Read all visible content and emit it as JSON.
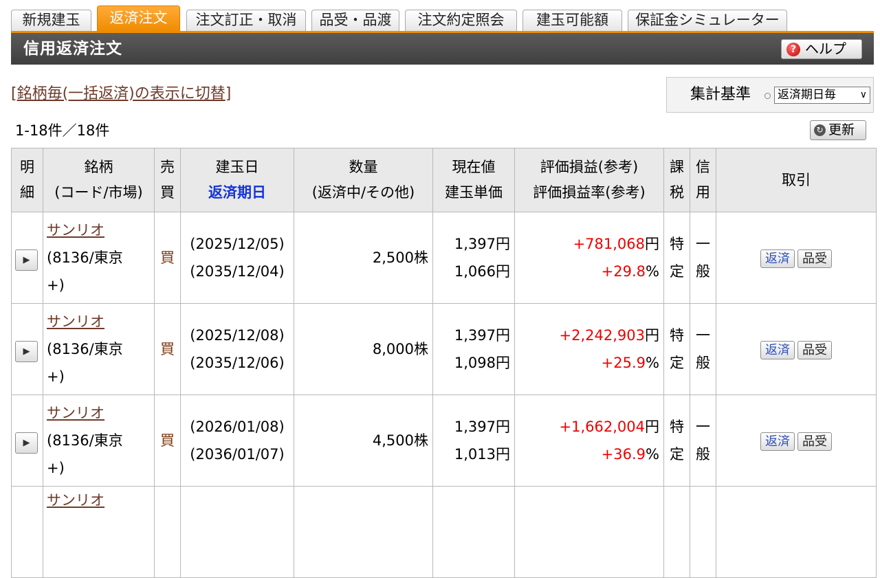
{
  "tabs": [
    {
      "label": "新規建玉",
      "active": false
    },
    {
      "label": "返済注文",
      "active": true
    },
    {
      "label": "注文訂正・取消",
      "active": false
    },
    {
      "label": "品受・品渡",
      "active": false
    },
    {
      "label": "注文約定照会",
      "active": false
    },
    {
      "label": "建玉可能額",
      "active": false
    },
    {
      "label": "保証金シミュレーター",
      "active": false
    }
  ],
  "title": "信用返済注文",
  "help_label": "ヘルプ",
  "toggle": {
    "open": "[",
    "label": "銘柄毎(一括返済)の表示に切替",
    "close": "]"
  },
  "aggregation": {
    "label": "集計基準",
    "selected": "返済期日毎"
  },
  "count": "1-18件／18件",
  "refresh_label": "更新",
  "headers": {
    "detail": [
      "明",
      "細"
    ],
    "stock": [
      "銘柄",
      "(コード/市場)"
    ],
    "side": [
      "売",
      "買"
    ],
    "date": [
      "建玉日",
      "返済期日"
    ],
    "qty": [
      "数量",
      "(返済中/その他)"
    ],
    "price": [
      "現在値",
      "建玉単価"
    ],
    "pl": [
      "評価損益(参考)",
      "評価損益率(参考)"
    ],
    "tax": [
      "課",
      "税"
    ],
    "credit": [
      "信",
      "用"
    ],
    "trade": "取引"
  },
  "rows": [
    {
      "name": "サンリオ",
      "code": "(8136/東京",
      "market": "+)",
      "side": "買",
      "open_date": "(2025/12/05)",
      "due_date": "(2035/12/04)",
      "qty": "2,500株",
      "current": "1,397円",
      "unit": "1,066円",
      "pl": "+781,068",
      "pl_unit": "円",
      "plr": "+29.8",
      "plr_unit": "%",
      "tax": [
        "特",
        "定"
      ],
      "credit": [
        "一",
        "般"
      ],
      "btn_return": "返済",
      "btn_deliver": "品受"
    },
    {
      "name": "サンリオ",
      "code": "(8136/東京",
      "market": "+)",
      "side": "買",
      "open_date": "(2025/12/08)",
      "due_date": "(2035/12/06)",
      "qty": "8,000株",
      "current": "1,397円",
      "unit": "1,098円",
      "pl": "+2,242,903",
      "pl_unit": "円",
      "plr": "+25.9",
      "plr_unit": "%",
      "tax": [
        "特",
        "定"
      ],
      "credit": [
        "一",
        "般"
      ],
      "btn_return": "返済",
      "btn_deliver": "品受"
    },
    {
      "name": "サンリオ",
      "code": "(8136/東京",
      "market": "+)",
      "side": "買",
      "open_date": "(2026/01/08)",
      "due_date": "(2036/01/07)",
      "qty": "4,500株",
      "current": "1,397円",
      "unit": "1,013円",
      "pl": "+1,662,004",
      "pl_unit": "円",
      "plr": "+36.9",
      "plr_unit": "%",
      "tax": [
        "特",
        "定"
      ],
      "credit": [
        "一",
        "般"
      ],
      "btn_return": "返済",
      "btn_deliver": "品受"
    }
  ],
  "partial_row_name": "サンリオ"
}
